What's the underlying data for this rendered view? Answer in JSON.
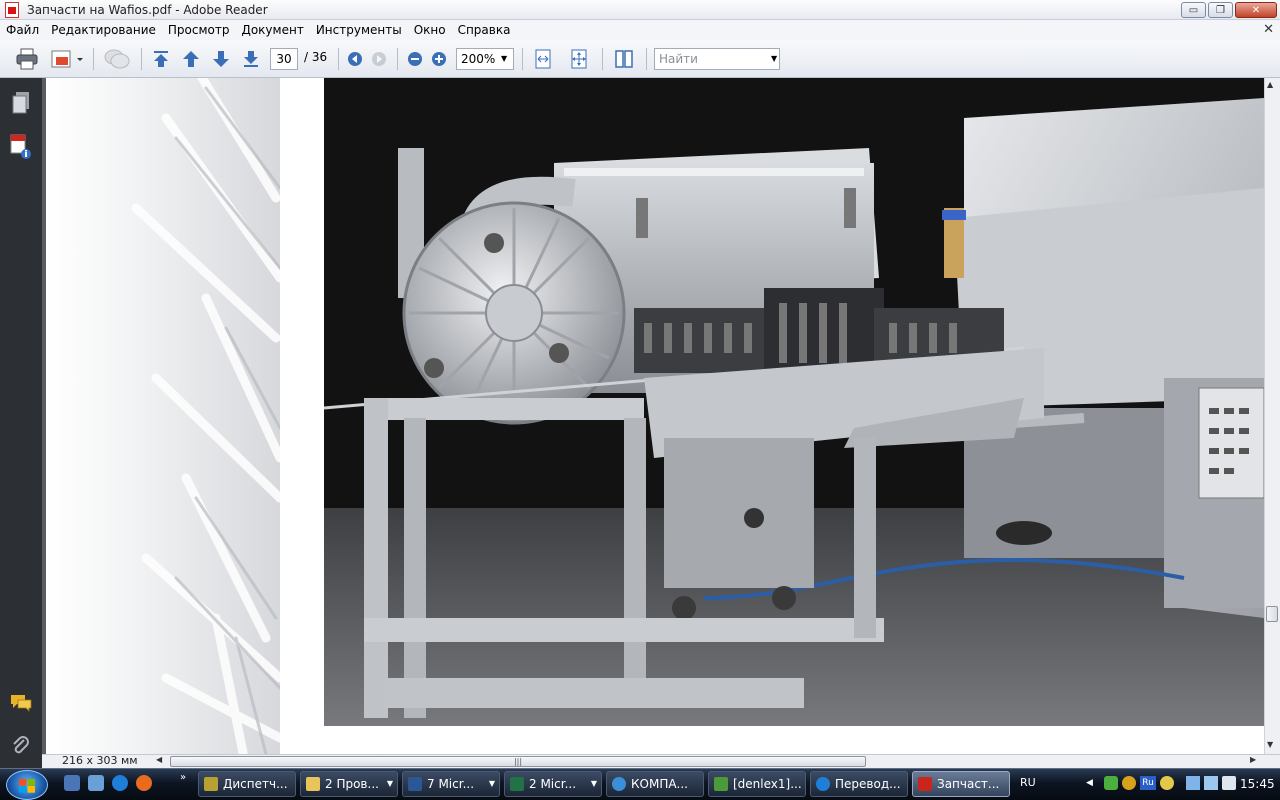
{
  "window": {
    "title": "Запчасти на Wafios.pdf - Adobe Reader",
    "buttons": {
      "minimize": "▭",
      "restore": "❐",
      "close": "✕"
    }
  },
  "menu": {
    "items": [
      "Файл",
      "Редактирование",
      "Просмотр",
      "Документ",
      "Инструменты",
      "Окно",
      "Справка"
    ],
    "close_doc": "✕"
  },
  "toolbar": {
    "current_page": "30",
    "total_pages": "/ 36",
    "zoom": "200%",
    "search_placeholder": "Найти"
  },
  "status": {
    "page_size": "216 x 303 мм"
  },
  "taskbar": {
    "tasks": [
      {
        "label": "Диспетч...",
        "icon_color": "#b8a032",
        "has_menu": false
      },
      {
        "label": "2 Пров...",
        "icon_color": "#e8c45a",
        "has_menu": true
      },
      {
        "label": "7 Micr...",
        "icon_color": "#2b5797",
        "has_menu": true
      },
      {
        "label": "2 Micr...",
        "icon_color": "#217346",
        "has_menu": true
      },
      {
        "label": "КОМПА...",
        "icon_color": "#3a8fd8",
        "has_menu": false
      },
      {
        "label": "[denlex1]...",
        "icon_color": "#4c9a3a",
        "has_menu": false
      },
      {
        "label": "Перевод...",
        "icon_color": "#1f7fd8",
        "has_menu": false
      },
      {
        "label": "Запчаст...",
        "icon_color": "#c8251c",
        "has_menu": false
      }
    ],
    "language": "RU",
    "clock": "15:45"
  },
  "colors": {
    "accent": "#3a6fb8",
    "taskbar": "#0d1522",
    "nav_panel": "#2c2f34"
  }
}
